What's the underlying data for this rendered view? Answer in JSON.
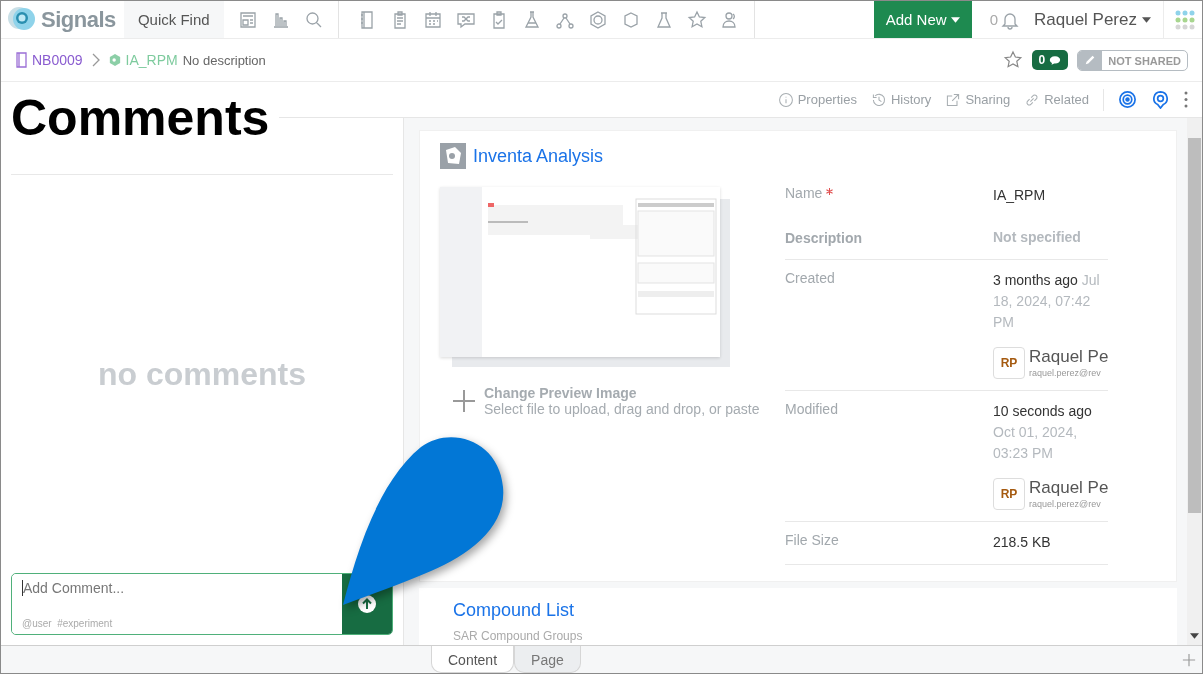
{
  "app": {
    "logo": "Signals",
    "quick_find": "Quick Find",
    "add_new": "Add New",
    "notifications": "0",
    "user": "Raquel Perez"
  },
  "breadcrumb": [
    {
      "label": "NB0009",
      "kind": "notebook"
    },
    {
      "label": "IA_RPM",
      "kind": "experiment"
    }
  ],
  "description": "No description",
  "comment_count": "0",
  "sharing": "NOT SHARED",
  "toolbar": [
    "Properties",
    "History",
    "Sharing",
    "Related"
  ],
  "comments": {
    "empty": "no comments",
    "placeholder": "Add Comment...",
    "hint": "@user  #experiment"
  },
  "document": {
    "title": "Inventa Analysis",
    "change_image": "Change Preview Image",
    "change_hint": "Select file to upload, drag and drop, or paste",
    "properties": [
      {
        "kind": "text",
        "label": "Name",
        "required": true,
        "value": "IA_RPM"
      },
      {
        "kind": "empty",
        "label": "Description",
        "required": false,
        "value": "Not specified"
      },
      {
        "kind": "time",
        "label": "Created",
        "required": false,
        "value": "3 months ago",
        "date": "Jul 18, 2024, 07:42 PM",
        "user": {
          "initials": "RP",
          "name": "Raquel Pe",
          "email": "raquel.perez@rev"
        }
      },
      {
        "kind": "time",
        "label": "Modified",
        "required": false,
        "value": "10 seconds ago",
        "date": "Oct 01, 2024, 03:23 PM",
        "user": {
          "initials": "RP",
          "name": "Raquel Pe",
          "email": "raquel.perez@rev"
        }
      },
      {
        "kind": "text",
        "label": "File Size",
        "required": false,
        "value": "218.5 KB"
      }
    ]
  },
  "section": {
    "title": "Compound List",
    "subtitle": "SAR Compound Groups"
  },
  "bottom_tabs": [
    {
      "label": "Content",
      "selected": true
    },
    {
      "label": "Page",
      "selected": false
    }
  ],
  "annotation": {
    "title": "Comments"
  }
}
